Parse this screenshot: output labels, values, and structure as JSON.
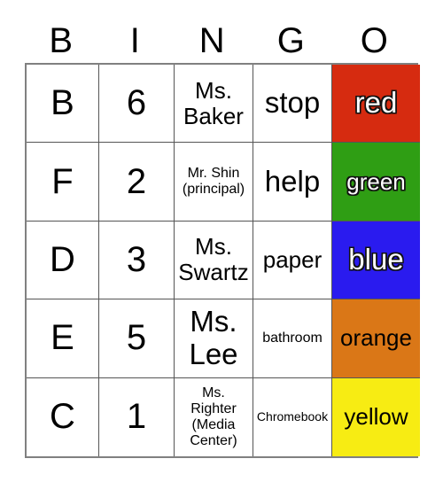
{
  "card": {
    "title": "BINGO",
    "headers": [
      "B",
      "I",
      "N",
      "G",
      "O"
    ],
    "rows": [
      {
        "b": "B",
        "i": "6",
        "n": "Ms.\nBaker",
        "g": "stop",
        "o": "red"
      },
      {
        "b": "F",
        "i": "2",
        "n": "Mr. Shin\n(principal)",
        "g": "help",
        "o": "green"
      },
      {
        "b": "D",
        "i": "3",
        "n": "Ms.\nSwartz",
        "g": "paper",
        "o": "blue"
      },
      {
        "b": "E",
        "i": "5",
        "n": "Ms.\nLee",
        "g": "bathroom",
        "o": "orange"
      },
      {
        "b": "C",
        "i": "1",
        "n": "Ms.\nRighter\n(Media\nCenter)",
        "g": "Chromebook",
        "o": "yellow"
      }
    ],
    "tile_colors": {
      "red": "#D62B10",
      "green": "#2F9E14",
      "blue": "#2A1BEF",
      "orange": "#DA7717",
      "yellow": "#F7EC13"
    },
    "grid_border_color": "#808080",
    "cell_line_color": "#555555"
  }
}
